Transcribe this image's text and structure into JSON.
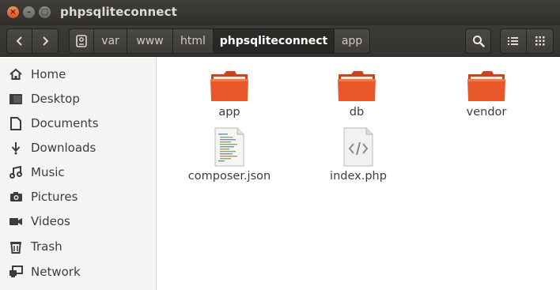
{
  "window": {
    "title": "phpsqliteconnect",
    "close_glyph": "×",
    "minimize_glyph": "–",
    "maximize_glyph": "□"
  },
  "toolbar": {
    "back_glyph": "‹",
    "forward_glyph": "›",
    "breadcrumbs": [
      "var",
      "www",
      "html",
      "phpsqliteconnect",
      "app"
    ],
    "active_crumb_index": 3
  },
  "sidebar": {
    "items": [
      {
        "label": "Home",
        "icon": "home-icon"
      },
      {
        "label": "Desktop",
        "icon": "desktop-folder-icon"
      },
      {
        "label": "Documents",
        "icon": "document-icon"
      },
      {
        "label": "Downloads",
        "icon": "download-arrow-icon"
      },
      {
        "label": "Music",
        "icon": "music-note-icon"
      },
      {
        "label": "Pictures",
        "icon": "camera-icon"
      },
      {
        "label": "Videos",
        "icon": "video-camera-icon"
      },
      {
        "label": "Trash",
        "icon": "trash-icon"
      },
      {
        "label": "Network",
        "icon": "network-icon"
      }
    ]
  },
  "files": [
    {
      "name": "app",
      "type": "folder"
    },
    {
      "name": "db",
      "type": "folder"
    },
    {
      "name": "vendor",
      "type": "folder"
    },
    {
      "name": "composer.json",
      "type": "text-file"
    },
    {
      "name": "index.php",
      "type": "code-file"
    }
  ],
  "colors": {
    "folder_orange": "#e8582a",
    "folder_tab": "#c9431c",
    "titlebar_bg": "#3a3935",
    "sidebar_bg": "#f5f4f2"
  }
}
